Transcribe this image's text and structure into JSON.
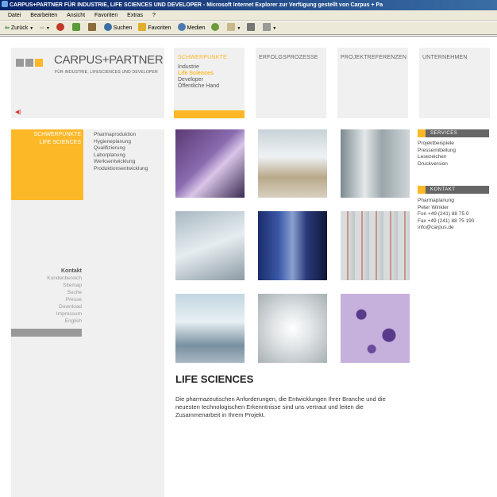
{
  "window": {
    "title": "CARPUS+PARTNER FÜR INDUSTRIE, LIFE SCIENCES UND DEVELOPER - Microsoft Internet Explorer  zur Verfügung gestellt von Carpus + Pa"
  },
  "menu": [
    "Datei",
    "Bearbeiten",
    "Ansicht",
    "Favoriten",
    "Extras",
    "?"
  ],
  "toolbar": {
    "back": "Zurück",
    "search": "Suchen",
    "favorites": "Favoriten",
    "media": "Medien"
  },
  "site": {
    "logo": "CARPUS+PARTNER",
    "tagline": "FÜR INDUSTRIE, LIFESCIENCES UND DEVELOPER",
    "sound_icon": "speaker-icon",
    "accent_color": "#fdb828",
    "nav": [
      {
        "label": "SCHWERPUNKTE",
        "sub": [
          "Industrie",
          "Life Sciences",
          "Developer",
          "Öffentliche Hand"
        ]
      },
      {
        "label": "ERFOLGSPROZESSE"
      },
      {
        "label": "PROJEKTREFERENZEN"
      },
      {
        "label": "UNTERNEHMEN"
      }
    ],
    "left_box": [
      "SCHWERPUNKTE",
      "LIFE SCIENCES"
    ],
    "sublinks": [
      "Pharmaproduktion",
      "Hygieneplanung",
      "Qualifizierung",
      "Laborplanung",
      "Werksentwicklung",
      "Produktionsentwicklung"
    ],
    "bottom_links": [
      "Kontakt",
      "Kundenbereich",
      "Sitemap",
      "Suche",
      "Presse",
      "Download",
      "Impressum",
      "English"
    ],
    "services": {
      "title": "SERVICES",
      "items": [
        "Projektbeispiele",
        "Pressemitteilung",
        "Lesezeichen",
        "Druckversion"
      ]
    },
    "contact": {
      "title": "KONTAKT",
      "lines": [
        "Pharmaplanung",
        "Peter Winkler",
        "Fon +49 (241) 88 75 0",
        "Fax +49 (241) 88 75 190",
        "info@carpus.de"
      ]
    },
    "heading": "LIFE SCIENCES",
    "body": "Die pharmazeutischen Anforderungen, die Entwicklungen Ihrer Branche und die neuesten technologischen Erkenntnisse sind uns vertraut und leiten die Zusammenarbeit in Ihrem Projekt."
  }
}
